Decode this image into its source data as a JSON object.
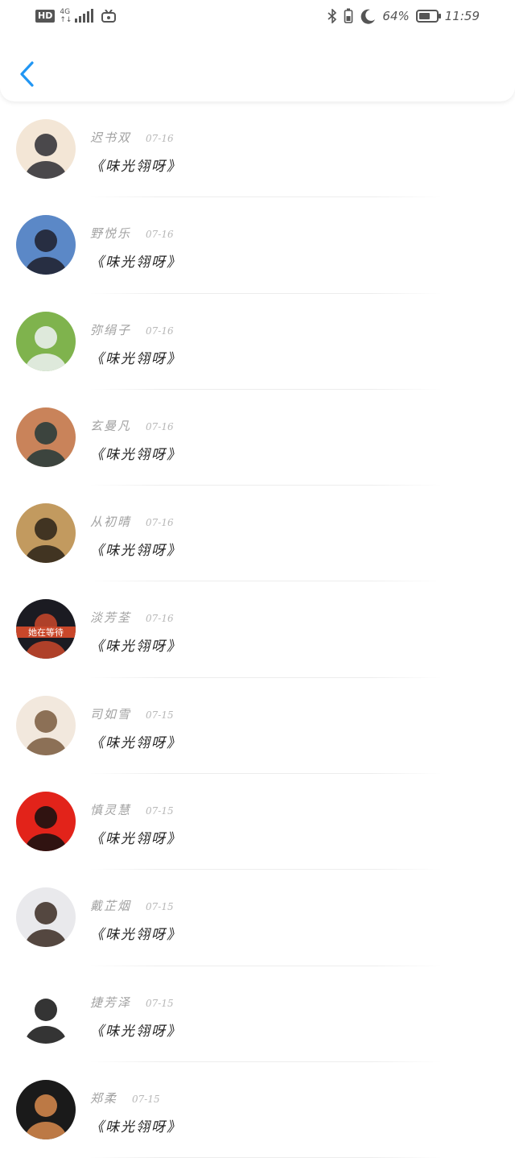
{
  "status_bar": {
    "hd": "HD",
    "network": "4G",
    "battery_percent": "64%",
    "battery_level": 0.64,
    "time": "11:59",
    "icons": [
      "signal-icon",
      "tv-icon",
      "bluetooth-icon",
      "vibrate-icon",
      "moon-icon",
      "battery-icon"
    ]
  },
  "header": {
    "back_icon": "chevron-left-icon",
    "accent_color": "#2196f3"
  },
  "contacts": [
    {
      "name": "迟书双",
      "date": "07-16",
      "message": "《味光翎呀》",
      "avatar_colors": [
        "#f3e6d6",
        "#2b2b33"
      ]
    },
    {
      "name": "野悦乐",
      "date": "07-16",
      "message": "《味光翎呀》",
      "avatar_colors": [
        "#5b88c7",
        "#1e1e2a"
      ]
    },
    {
      "name": "弥绢子",
      "date": "07-16",
      "message": "《味光翎呀》",
      "avatar_colors": [
        "#7fb34d",
        "#eef2f5"
      ]
    },
    {
      "name": "玄曼凡",
      "date": "07-16",
      "message": "《味光翎呀》",
      "avatar_colors": [
        "#c9835a",
        "#233a3a"
      ]
    },
    {
      "name": "从初晴",
      "date": "07-16",
      "message": "《味光翎呀》",
      "avatar_colors": [
        "#c29a5f",
        "#2a2218"
      ]
    },
    {
      "name": "淡芳荃",
      "date": "07-16",
      "message": "《味光翎呀》",
      "avatar_colors": [
        "#1b1b22",
        "#c9472a"
      ],
      "avatar_text": "她在等待"
    },
    {
      "name": "司如雪",
      "date": "07-15",
      "message": "《味光翎呀》",
      "avatar_colors": [
        "#f2e8dd",
        "#7a5b3e"
      ]
    },
    {
      "name": "慎灵慧",
      "date": "07-15",
      "message": "《味光翎呀》",
      "avatar_colors": [
        "#e2231a",
        "#111111"
      ]
    },
    {
      "name": "戴芷烟",
      "date": "07-15",
      "message": "《味光翎呀》",
      "avatar_colors": [
        "#e9e9ec",
        "#3a2a22"
      ]
    },
    {
      "name": "捷芳泽",
      "date": "07-15",
      "message": "《味光翎呀》",
      "avatar_colors": [
        "#ffffff",
        "#111111"
      ]
    },
    {
      "name": "郑柔",
      "date": "07-15",
      "message": "《味光翎呀》",
      "avatar_colors": [
        "#1a1a1a",
        "#d98b4e"
      ]
    }
  ]
}
